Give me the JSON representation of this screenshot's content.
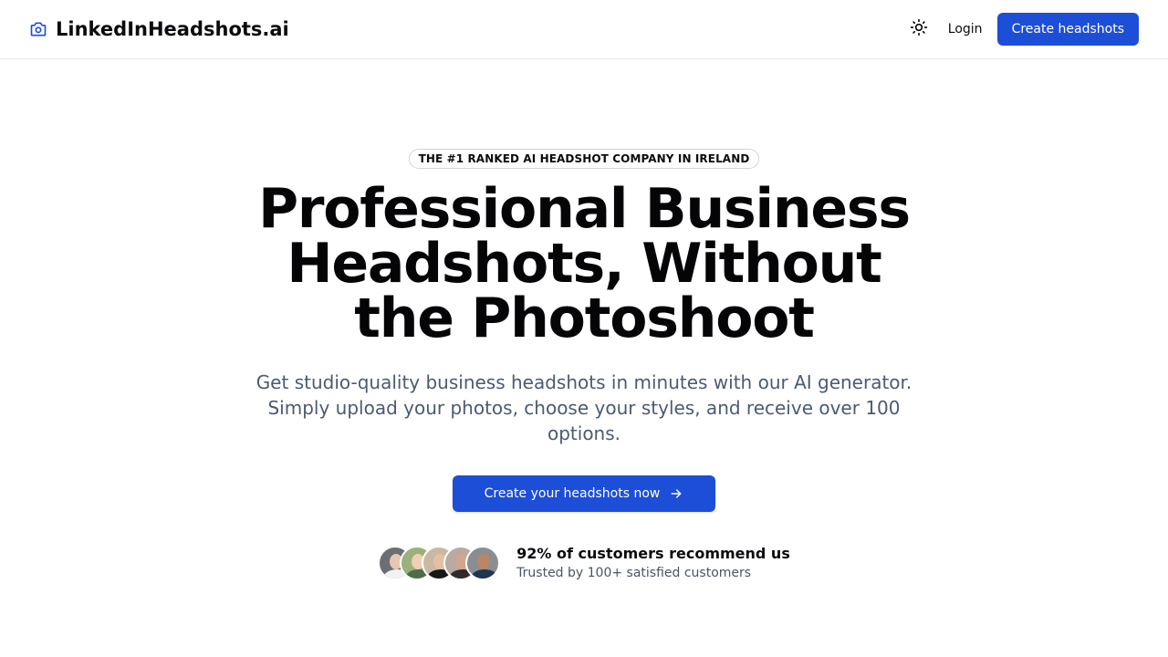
{
  "header": {
    "brand_name": "LinkedInHeadshots.ai",
    "brand_icon": "camera-icon",
    "theme_icon": "sun-icon",
    "login_label": "Login",
    "cta_label": "Create headshots"
  },
  "hero": {
    "badge": "THE #1 RANKED AI HEADSHOT COMPANY IN IRELAND",
    "headline": "Professional Business Headshots, Without the Photoshoot",
    "subtext": "Get studio-quality business headshots in minutes with our AI generator. Simply upload your photos, choose your styles, and receive over 100 options.",
    "cta_label": "Create your headshots now",
    "cta_icon": "arrow-right-icon"
  },
  "social_proof": {
    "title": "92% of customers recommend us",
    "subtitle": "Trusted by 100+ satisfied customers",
    "avatar_count": 5
  },
  "colors": {
    "accent": "#1d4ed8",
    "text": "#0b0b0f",
    "muted": "#4b5a72",
    "border": "#e5e7eb"
  }
}
